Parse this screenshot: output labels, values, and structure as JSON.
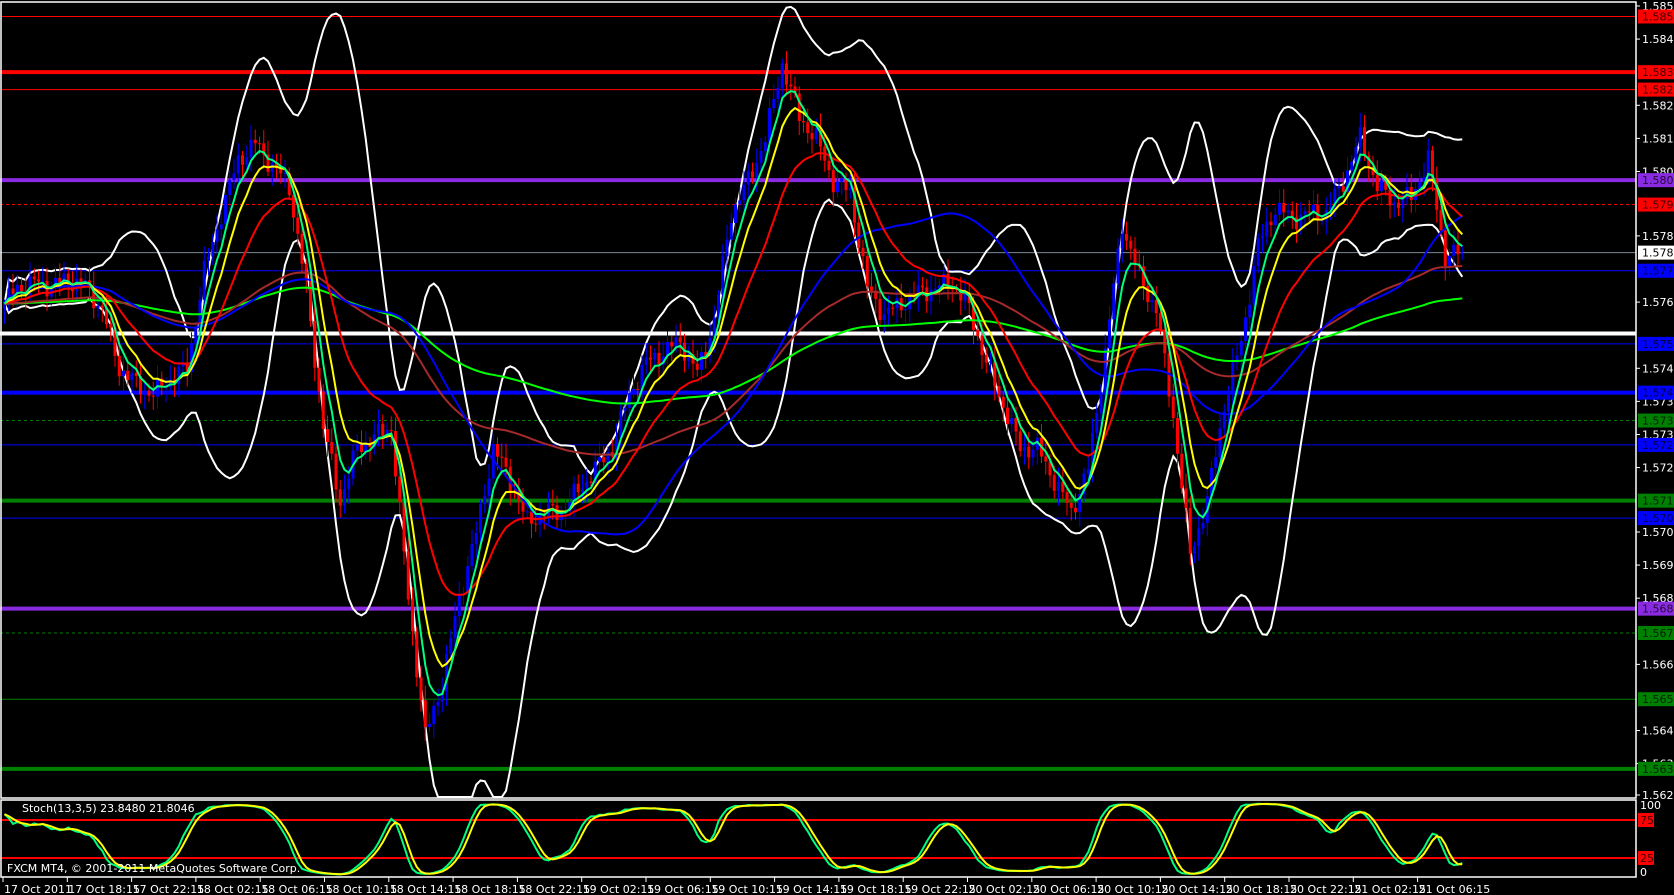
{
  "chart_data": {
    "type": "candlestick",
    "symbol_timeframe": "M15",
    "x_tick_labels": [
      "17 Oct 2011",
      "17 Oct 18:15",
      "17 Oct 22:15",
      "18 Oct 02:15",
      "18 Oct 06:15",
      "18 Oct 10:15",
      "18 Oct 14:15",
      "18 Oct 18:15",
      "18 Oct 22:15",
      "19 Oct 02:15",
      "19 Oct 06:15",
      "19 Oct 10:15",
      "19 Oct 14:15",
      "19 Oct 18:15",
      "19 Oct 22:15",
      "20 Oct 02:15",
      "20 Oct 06:15",
      "20 Oct 10:15",
      "20 Oct 14:15",
      "20 Oct 18:15",
      "20 Oct 22:15",
      "21 Oct 02:15",
      "21 Oct 06:15"
    ],
    "y_tick_labels": [
      "1.58530",
      "1.58435",
      "1.58245",
      "1.58150",
      "1.58055",
      "1.57870",
      "1.57680",
      "1.57490",
      "1.57395",
      "1.57300",
      "1.57205",
      "1.57020",
      "1.56925",
      "1.56830",
      "1.56640",
      "1.56450",
      "1.56355",
      "1.56265"
    ],
    "ylim": [
      1.56265,
      1.5853
    ],
    "current_price": "1.57822",
    "approx_hourly_closes": [
      1.5766,
      1.57721,
      1.57736,
      1.57727,
      1.57745,
      1.57727,
      1.5766,
      1.57491,
      1.57445,
      1.57414,
      1.5746,
      1.57491,
      1.57767,
      1.57935,
      1.58089,
      1.58135,
      1.58073,
      1.58012,
      1.57721,
      1.57322,
      1.57108,
      1.57261,
      1.57292,
      1.57322,
      1.56832,
      1.56434,
      1.56587,
      1.56832,
      1.57016,
      1.57261,
      1.57169,
      1.57047,
      1.57077,
      1.57077,
      1.57139,
      1.572,
      1.57261,
      1.57414,
      1.57506,
      1.57537,
      1.57568,
      1.57476,
      1.57629,
      1.57935,
      1.58027,
      1.5815,
      1.58365,
      1.58211,
      1.5815,
      1.58027,
      1.57997,
      1.57721,
      1.57644,
      1.57675,
      1.57706,
      1.57721,
      1.57736,
      1.5766,
      1.57506,
      1.57384,
      1.57261,
      1.57261,
      1.57169,
      1.57077,
      1.572,
      1.57537,
      1.57905,
      1.57752,
      1.5766,
      1.57353,
      1.56955,
      1.57108,
      1.57384,
      1.57568,
      1.57843,
      1.57951,
      1.5792,
      1.57935,
      1.57935,
      1.58027,
      1.5815,
      1.58012,
      1.57966,
      1.57981,
      1.58089,
      1.57813,
      1.57822
    ],
    "horizontal_levels": [
      {
        "price": "1.58500",
        "color": "#ff0000",
        "style": "thin"
      },
      {
        "price": "1.58340",
        "color": "#ff0000",
        "style": "thick"
      },
      {
        "price": "1.58290",
        "color": "#ff0000",
        "style": "thin"
      },
      {
        "price": "1.58030",
        "color": "#8a2be2",
        "style": "thick"
      },
      {
        "price": "1.57960",
        "color": "#ff0000",
        "style": "dashed"
      },
      {
        "price": "1.57822",
        "color": "#ffffff",
        "style": "current",
        "line_color": "#778899"
      },
      {
        "price": "1.57770",
        "color": "#0000ff",
        "style": "thin"
      },
      {
        "price": "1.57590",
        "color": "#ffffff",
        "style": "thick",
        "nolabel": true
      },
      {
        "price": "1.57560",
        "color": "#0000ff",
        "style": "thin"
      },
      {
        "price": "1.57420",
        "color": "#0000ff",
        "style": "thick"
      },
      {
        "price": "1.57340",
        "color": "#008000",
        "style": "dashed"
      },
      {
        "price": "1.57270",
        "color": "#0000ff",
        "style": "thin"
      },
      {
        "price": "1.57110",
        "color": "#008000",
        "style": "thick"
      },
      {
        "price": "1.57060",
        "color": "#0000ff",
        "style": "thin"
      },
      {
        "price": "1.56800",
        "color": "#8a2be2",
        "style": "thick"
      },
      {
        "price": "1.56730",
        "color": "#008000",
        "style": "dashed"
      },
      {
        "price": "1.56540",
        "color": "#008000",
        "style": "thin"
      },
      {
        "price": "1.56340",
        "color": "#008000",
        "style": "thick"
      }
    ],
    "indicators": {
      "moving_averages": [
        {
          "color": "#00ff7f"
        },
        {
          "color": "#ffff00"
        },
        {
          "color": "#ff0000"
        },
        {
          "color": "#0000ff"
        },
        {
          "color": "#a52a2a"
        },
        {
          "color": "#00ff00"
        }
      ],
      "bollinger_color": "#ffffff",
      "bull_color": "#0000ff",
      "bear_color": "#ff0000"
    },
    "stochastic": {
      "label": "Stoch(13,3,5) 23.8480 21.8046",
      "levels": [
        "75",
        "25"
      ],
      "scale": [
        "100",
        "0"
      ],
      "main_color": "#00ff7f",
      "signal_color": "#ffff00",
      "level_color": "#ff0000"
    }
  },
  "footer": {
    "copyright": "FXCM MT4, © 2001-2011 MetaQuotes Software Corp."
  }
}
